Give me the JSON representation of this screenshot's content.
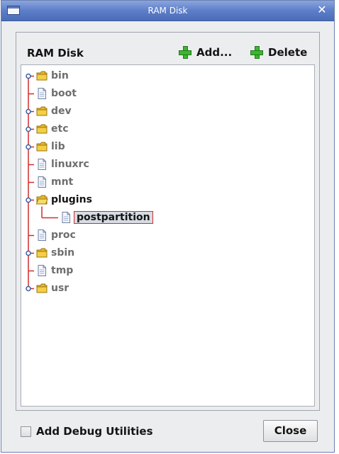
{
  "window": {
    "title": "RAM Disk",
    "close_glyph": "✕"
  },
  "panel": {
    "title": "RAM Disk",
    "add_label": "Add...",
    "delete_label": "Delete"
  },
  "tree": {
    "nodes": [
      {
        "label": "bin",
        "type": "folder",
        "depth": 0,
        "expandable": true
      },
      {
        "label": "boot",
        "type": "file",
        "depth": 0,
        "expandable": false
      },
      {
        "label": "dev",
        "type": "folder",
        "depth": 0,
        "expandable": true
      },
      {
        "label": "etc",
        "type": "folder",
        "depth": 0,
        "expandable": true
      },
      {
        "label": "lib",
        "type": "folder",
        "depth": 0,
        "expandable": true
      },
      {
        "label": "linuxrc",
        "type": "file",
        "depth": 0,
        "expandable": false
      },
      {
        "label": "mnt",
        "type": "file",
        "depth": 0,
        "expandable": false
      },
      {
        "label": "plugins",
        "type": "folder-open",
        "depth": 0,
        "expandable": true,
        "expanded": true
      },
      {
        "label": "postpartition",
        "type": "file",
        "depth": 1,
        "expandable": false,
        "selected": true
      },
      {
        "label": "proc",
        "type": "file",
        "depth": 0,
        "expandable": false
      },
      {
        "label": "sbin",
        "type": "folder",
        "depth": 0,
        "expandable": true
      },
      {
        "label": "tmp",
        "type": "file",
        "depth": 0,
        "expandable": false
      },
      {
        "label": "usr",
        "type": "folder",
        "depth": 0,
        "expandable": true
      }
    ]
  },
  "footer": {
    "checkbox_label": "Add Debug Utilities",
    "checkbox_checked": false,
    "close_label": "Close"
  },
  "colors": {
    "titlebar": "#5d7ec8",
    "tree_line": "#d42c2c",
    "selection_border": "#d42c2c",
    "plus_icon": "#3ab72e"
  }
}
